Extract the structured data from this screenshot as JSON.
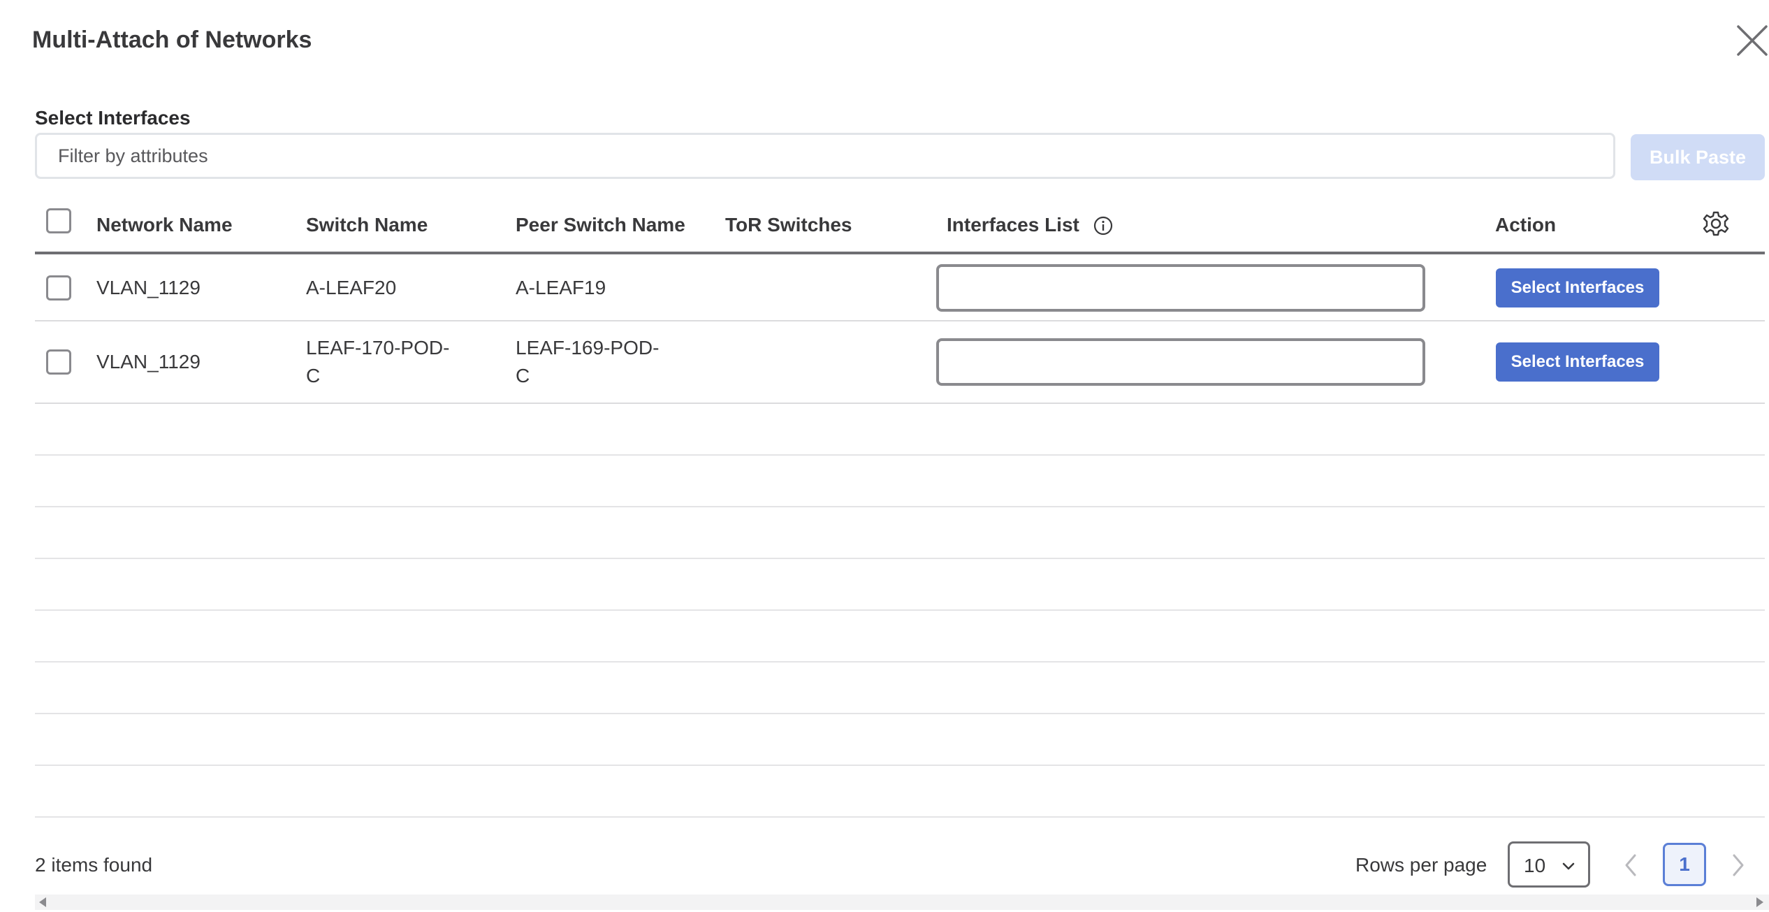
{
  "modal": {
    "title": "Multi-Attach of Networks"
  },
  "filter": {
    "section_label": "Select Interfaces",
    "placeholder": "Filter by attributes",
    "bulk_paste_label": "Bulk Paste"
  },
  "table": {
    "columns": {
      "network_name": "Network Name",
      "switch_name": "Switch Name",
      "peer_switch_name": "Peer Switch Name",
      "tor_switches": "ToR Switches",
      "interfaces_list": "Interfaces List",
      "action": "Action"
    },
    "rows": [
      {
        "network_name": "VLAN_1129",
        "switch_name_line1": "A-LEAF20",
        "switch_name_line2": "",
        "peer_switch_name_line1": "A-LEAF19",
        "peer_switch_name_line2": "",
        "tor_switches": "",
        "interfaces_value": "",
        "action_label": "Select Interfaces"
      },
      {
        "network_name": "VLAN_1129",
        "switch_name_line1": "LEAF-170-POD-",
        "switch_name_line2": "C",
        "peer_switch_name_line1": "LEAF-169-POD-",
        "peer_switch_name_line2": "C",
        "tor_switches": "",
        "interfaces_value": "",
        "action_label": "Select Interfaces"
      }
    ]
  },
  "footer": {
    "items_found": "2 items found",
    "rows_per_page_label": "Rows per page",
    "rows_per_page_value": "10",
    "current_page": "1"
  },
  "colors": {
    "primary": "#4a6fcc",
    "primary_disabled": "#d0dcf6",
    "text": "#39393b"
  },
  "icons": {
    "close": "close-icon",
    "info": "info-icon",
    "settings": "gear-icon",
    "chevron_down": "chevron-down-icon",
    "prev": "chevron-left-icon",
    "next": "chevron-right-icon"
  }
}
